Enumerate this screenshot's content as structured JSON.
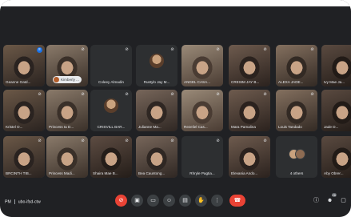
{
  "meeting": {
    "time": "PM",
    "code": "ubo-ifsd-ctw"
  },
  "participants": [
    {
      "name": "Geanne Gatd...",
      "row": 0,
      "col": 0,
      "video": true,
      "mic_active": true
    },
    {
      "name": "Kimberly ...",
      "row": 0,
      "col": 1,
      "video": true,
      "pill": true
    },
    {
      "name": "Coleey Almadin",
      "row": 0,
      "col": 2,
      "video": false
    },
    {
      "name": "Rustylo Jay M...",
      "row": 0,
      "col": 3,
      "video": false,
      "avatar_img": true
    },
    {
      "name": "ANGEL CASA...",
      "row": 0,
      "col": 4,
      "video": true
    },
    {
      "name": "CRESIM JAY B...",
      "row": 0,
      "col": 5,
      "video": true
    },
    {
      "name": "ALEXA JADE...",
      "row": 0,
      "col": 6,
      "video": true
    },
    {
      "name": "Ivy Mae Ja...",
      "row": 0,
      "col": 7,
      "video": true
    },
    {
      "name": "Kristel O...",
      "row": 1,
      "col": 0,
      "video": true
    },
    {
      "name": "Princess Ia D...",
      "row": 1,
      "col": 1,
      "video": true
    },
    {
      "name": "CRISVILL BAR...",
      "row": 1,
      "col": 2,
      "video": false,
      "avatar_img": true
    },
    {
      "name": "Julianne Ma...",
      "row": 1,
      "col": 3,
      "video": true
    },
    {
      "name": "Rezeliel Cas...",
      "row": 1,
      "col": 4,
      "video": true
    },
    {
      "name": "Mara Pamalina",
      "row": 1,
      "col": 5,
      "video": true
    },
    {
      "name": "Louis Tandado",
      "row": 1,
      "col": 6,
      "video": true
    },
    {
      "name": "Jade D...",
      "row": 1,
      "col": 7,
      "video": true
    },
    {
      "name": "BRCINTH TIB...",
      "row": 2,
      "col": 0,
      "video": true
    },
    {
      "name": "Princess Madi...",
      "row": 2,
      "col": 1,
      "video": true
    },
    {
      "name": "Shaira Mae B...",
      "row": 2,
      "col": 2,
      "video": true
    },
    {
      "name": "Bea Cauntong...",
      "row": 2,
      "col": 3,
      "video": true
    },
    {
      "name": "Rhryle Pagtia...",
      "row": 2,
      "col": 4,
      "video": false
    },
    {
      "name": "Elevania Ando...",
      "row": 2,
      "col": 5,
      "video": true
    },
    {
      "name": "4 others",
      "row": 2,
      "col": 6,
      "video": false,
      "others": true
    },
    {
      "name": "Aby Obrer...",
      "row": 2,
      "col": 7,
      "video": true
    }
  ],
  "controls": [
    {
      "name": "mic-button",
      "icon": "mic-off-icon",
      "glyph": "⊘",
      "style": "red"
    },
    {
      "name": "camera-button",
      "icon": "camera-icon",
      "glyph": "▣",
      "style": "normal"
    },
    {
      "name": "captions-button",
      "icon": "captions-icon",
      "glyph": "▭",
      "style": "normal"
    },
    {
      "name": "emoji-button",
      "icon": "emoji-icon",
      "glyph": "☺",
      "style": "normal"
    },
    {
      "name": "present-button",
      "icon": "present-icon",
      "glyph": "▤",
      "style": "normal"
    },
    {
      "name": "raise-hand-button",
      "icon": "hand-icon",
      "glyph": "✋",
      "style": "normal"
    },
    {
      "name": "more-options-button",
      "icon": "more-vert-icon",
      "glyph": "⋮",
      "style": "normal"
    },
    {
      "name": "end-call-button",
      "icon": "phone-hangup-icon",
      "glyph": "☎",
      "style": "end"
    }
  ],
  "right_controls": [
    {
      "name": "info-button",
      "icon": "info-icon",
      "glyph": "ⓘ"
    },
    {
      "name": "people-button",
      "icon": "people-icon",
      "glyph": "☻",
      "badge": "26"
    },
    {
      "name": "chat-button",
      "icon": "chat-icon",
      "glyph": "▢"
    }
  ],
  "colors": {
    "background": "#202124",
    "tile": "#3c4043",
    "accent_red": "#ea4335",
    "accent_blue": "#1a73e8"
  }
}
